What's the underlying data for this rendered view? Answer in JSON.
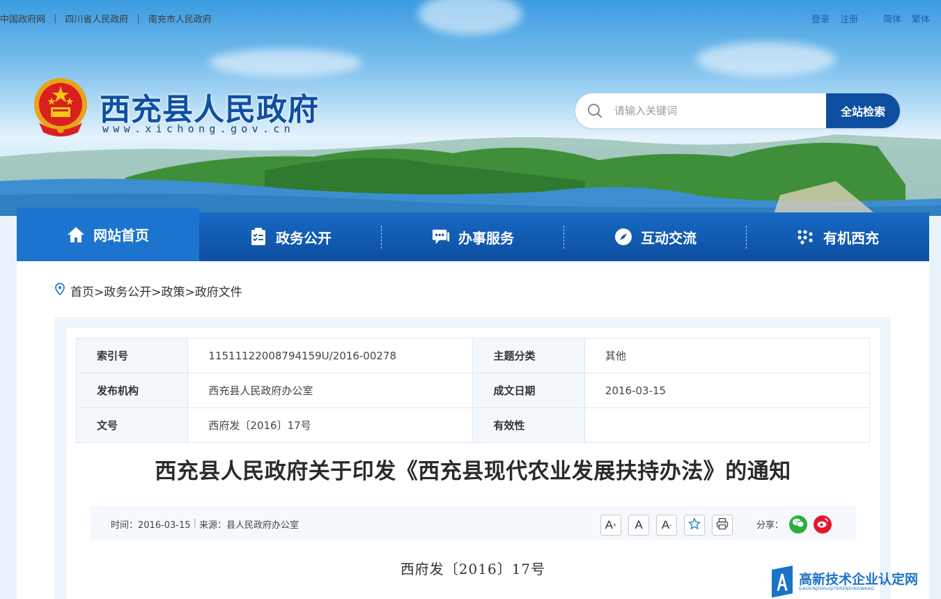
{
  "top_links": [
    "中国政府网",
    "四川省人民政府",
    "南充市人民政府"
  ],
  "user_links": [
    "登录",
    "注册",
    "简体",
    "繁体"
  ],
  "site": {
    "title": "西充县人民政府",
    "url": "www.xichong.gov.cn"
  },
  "search": {
    "placeholder": "请输入关键词",
    "button": "全站检索"
  },
  "nav": [
    {
      "label": "网站首页",
      "icon": "home-icon",
      "active": true
    },
    {
      "label": "政务公开",
      "icon": "clipboard-icon",
      "active": false
    },
    {
      "label": "办事服务",
      "icon": "chat-icon",
      "active": false
    },
    {
      "label": "互动交流",
      "icon": "compass-icon",
      "active": false
    },
    {
      "label": "有机西充",
      "icon": "dots-icon",
      "active": false
    }
  ],
  "breadcrumb": "首页>政务公开>政策>政府文件",
  "info": {
    "index_label": "索引号",
    "index_value": "11511122008794159U/2016-00278",
    "topic_label": "主题分类",
    "topic_value": "其他",
    "org_label": "发布机构",
    "org_value": "西充县人民政府办公室",
    "date_label": "成文日期",
    "date_value": "2016-03-15",
    "docno_label": "文号",
    "docno_value": "西府发〔2016〕17号",
    "validity_label": "有效性",
    "validity_value": ""
  },
  "document": {
    "title": "西充县人民政府关于印发《西充县现代农业发展扶持办法》的通知",
    "time_text": "时间：2016-03-15",
    "source_text": "来源：县人民政府办公室",
    "number": "西府发〔2016〕17号"
  },
  "tools": {
    "font_large": "A",
    "font_normal": "A",
    "font_small": "A",
    "share_label": "分享："
  },
  "watermark": {
    "text": "高新技术企业认定网",
    "sub": "GAOXINJISHUQIYERENDINGWANG"
  },
  "colors": {
    "primary": "#0d4e9f",
    "nav_active": "#1c74cf",
    "title_blue": "#0f4fa3",
    "wechat": "#2aae3f",
    "weibo": "#e6162d"
  }
}
